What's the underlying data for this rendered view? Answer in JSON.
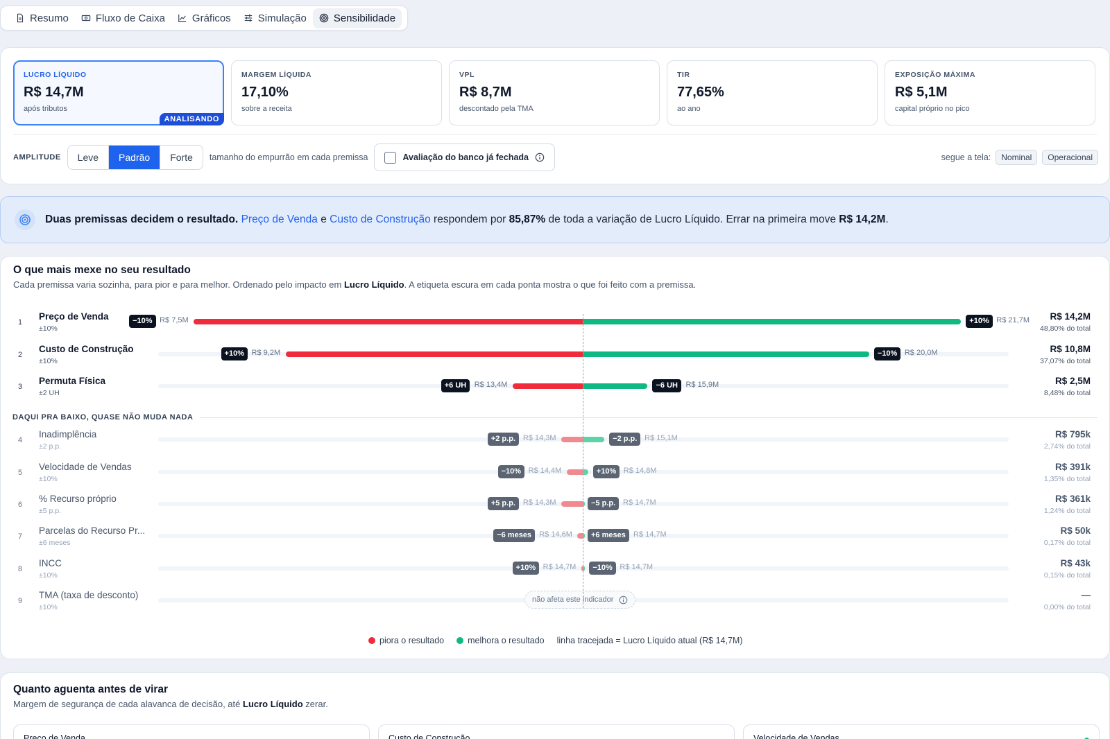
{
  "tabs": [
    {
      "label": "Resumo",
      "icon": "document-icon"
    },
    {
      "label": "Fluxo de Caixa",
      "icon": "cash-icon"
    },
    {
      "label": "Gráficos",
      "icon": "chart-icon"
    },
    {
      "label": "Simulação",
      "icon": "sliders-icon"
    },
    {
      "label": "Sensibilidade",
      "icon": "target-icon",
      "active": true
    }
  ],
  "kpis": [
    {
      "label": "LUCRO LÍQUIDO",
      "value": "R$ 14,7M",
      "sub": "após tributos",
      "badge": "ANALISANDO",
      "selected": true
    },
    {
      "label": "MARGEM LÍQUIDA",
      "value": "17,10%",
      "sub": "sobre a receita"
    },
    {
      "label": "VPL",
      "value": "R$ 8,7M",
      "sub": "descontado pela TMA"
    },
    {
      "label": "TIR",
      "value": "77,65%",
      "sub": "ao ano"
    },
    {
      "label": "EXPOSIÇÃO MÁXIMA",
      "value": "R$ 5,1M",
      "sub": "capital próprio no pico"
    }
  ],
  "amplitude": {
    "label": "AMPLITUDE",
    "options": [
      "Leve",
      "Padrão",
      "Forte"
    ],
    "selected": "Padrão",
    "help": "tamanho do empurrão em cada premissa"
  },
  "bank_check": {
    "label": "Avaliação do banco já fechada",
    "checked": false
  },
  "follow": {
    "label": "segue a tela:",
    "chips": [
      "Nominal",
      "Operacional"
    ]
  },
  "banner": {
    "lead": "Duas premissas decidem o resultado.",
    "p1": "Preço de Venda",
    "and": "e",
    "p2": "Custo de Construção",
    "mid": "respondem por",
    "pct": "85,87%",
    "mid2": "de toda a variação de Lucro Líquido. Errar na primeira move",
    "amount": "R$ 14,2M",
    "end": "."
  },
  "tornado": {
    "title": "O que mais mexe no seu resultado",
    "sub_pre": "Cada premissa varia sozinha, para pior e para melhor. Ordenado pelo impacto em",
    "sub_bold": "Lucro Líquido",
    "sub_post": ". A etiqueta escura em cada ponta mostra o que foi feito com a premissa.",
    "minor_label": "DAQUI PRA BAIXO, QUASE NÃO MUDA NADA",
    "na_label": "não afeta este indicador",
    "legend": {
      "worse": "piora o resultado",
      "better": "melhora o resultado",
      "line": "linha tracejada = Lucro Líquido atual (R$ 14,7M)"
    }
  },
  "chart_data": {
    "type": "bar",
    "subtype": "tornado",
    "baseline": 14.7,
    "unit": "R$ M",
    "worse_color": "#ef2b3c",
    "better_color": "#10b981",
    "rows": [
      {
        "rank": "1",
        "name": "Preço de Venda",
        "range": "±10%",
        "low_tag": "−10%",
        "low_label": "R$ 7,5M",
        "low": 7.5,
        "high_tag": "+10%",
        "high_label": "R$ 21,7M",
        "high": 21.7,
        "total": "R$ 14,2M",
        "pct": "48,80% do total"
      },
      {
        "rank": "2",
        "name": "Custo de Construção",
        "range": "±10%",
        "low_tag": "+10%",
        "low_label": "R$ 9,2M",
        "low": 9.2,
        "high_tag": "−10%",
        "high_label": "R$ 20,0M",
        "high": 20.0,
        "total": "R$ 10,8M",
        "pct": "37,07% do total"
      },
      {
        "rank": "3",
        "name": "Permuta Física",
        "range": "±2 UH",
        "low_tag": "+6 UH",
        "low_label": "R$ 13,4M",
        "low": 13.4,
        "high_tag": "−6 UH",
        "high_label": "R$ 15,9M",
        "high": 15.9,
        "total": "R$ 2,5M",
        "pct": "8,48% do total"
      },
      {
        "rank": "4",
        "name": "Inadimplência",
        "range": "±2 p.p.",
        "low_tag": "+2 p.p.",
        "low_label": "R$ 14,3M",
        "low": 14.3,
        "high_tag": "−2 p.p.",
        "high_label": "R$ 15,1M",
        "high": 15.1,
        "total": "R$ 795k",
        "pct": "2,74% do total",
        "minor": true
      },
      {
        "rank": "5",
        "name": "Velocidade de Vendas",
        "range": "±10%",
        "low_tag": "−10%",
        "low_label": "R$ 14,4M",
        "low": 14.4,
        "high_tag": "+10%",
        "high_label": "R$ 14,8M",
        "high": 14.8,
        "total": "R$ 391k",
        "pct": "1,35% do total",
        "minor": true
      },
      {
        "rank": "6",
        "name": "% Recurso próprio",
        "range": "±5 p.p.",
        "low_tag": "+5 p.p.",
        "low_label": "R$ 14,3M",
        "low": 14.3,
        "high_tag": "−5 p.p.",
        "high_label": "R$ 14,7M",
        "high": 14.7,
        "total": "R$ 361k",
        "pct": "1,24% do total",
        "minor": true
      },
      {
        "rank": "7",
        "name": "Parcelas do Recurso Pr...",
        "range": "±6 meses",
        "low_tag": "−6 meses",
        "low_label": "R$ 14,6M",
        "low": 14.6,
        "high_tag": "+6 meses",
        "high_label": "R$ 14,7M",
        "high": 14.7,
        "total": "R$ 50k",
        "pct": "0,17% do total",
        "minor": true
      },
      {
        "rank": "8",
        "name": "INCC",
        "range": "±10%",
        "low_tag": "+10%",
        "low_label": "R$ 14,7M",
        "low": 14.67,
        "high_tag": "−10%",
        "high_label": "R$ 14,7M",
        "high": 14.73,
        "total": "R$ 43k",
        "pct": "0,15% do total",
        "minor": true
      },
      {
        "rank": "9",
        "name": "TMA (taxa de desconto)",
        "range": "±10%",
        "na": true,
        "total": "—",
        "pct": "0,00% do total",
        "minor": true
      }
    ]
  },
  "margin": {
    "title": "Quanto aguenta antes de virar",
    "sub_pre": "Margem de segurança de cada alavanca de decisão, até",
    "sub_bold": "Lucro Líquido",
    "sub_post": "zerar.",
    "cards": [
      "Preço de Venda",
      "Custo de Construção",
      "Velocidade de Vendas"
    ]
  }
}
